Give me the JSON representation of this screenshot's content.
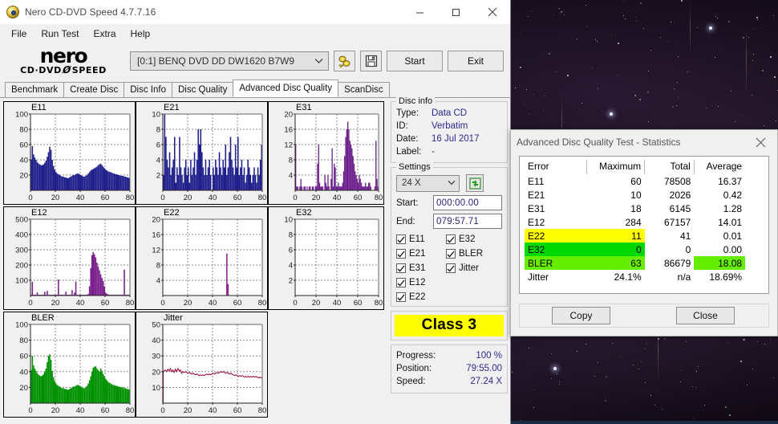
{
  "window": {
    "title": "Nero CD-DVD Speed 4.7.7.16",
    "icon": "nero-disc-icon",
    "minimize_label": "–",
    "maximize_label": "□",
    "close_label": "✕"
  },
  "menubar": [
    {
      "label": "File"
    },
    {
      "label": "Run Test"
    },
    {
      "label": "Extra"
    },
    {
      "label": "Help"
    }
  ],
  "logo": {
    "top": "nero",
    "bottom_left": "CD·DVD",
    "bottom_right": "SPEED"
  },
  "toolbar": {
    "drive_value": "[0:1]   BENQ DVD DD DW1620 B7W9",
    "eject_icon": "eject-disc-icon",
    "save_icon": "floppy-save-icon",
    "start_label": "Start",
    "exit_label": "Exit"
  },
  "tabs": [
    {
      "label": "Benchmark",
      "active": false
    },
    {
      "label": "Create Disc",
      "active": false
    },
    {
      "label": "Disc Info",
      "active": false
    },
    {
      "label": "Disc Quality",
      "active": false
    },
    {
      "label": "Advanced Disc Quality",
      "active": true
    },
    {
      "label": "ScanDisc",
      "active": false
    }
  ],
  "disc_info": {
    "legend": "Disc info",
    "rows": [
      {
        "key": "Type:",
        "value": "Data CD"
      },
      {
        "key": "ID:",
        "value": "Verbatim"
      },
      {
        "key": "Date:",
        "value": "16 Jul 2017"
      },
      {
        "key": "Label:",
        "value": "-"
      }
    ]
  },
  "settings": {
    "legend": "Settings",
    "speed_value": "24 X",
    "refresh_icon": "refresh-icon",
    "start_label": "Start:",
    "start_value": "000:00.00",
    "end_label": "End:",
    "end_value": "079:57.71",
    "checkboxes": [
      {
        "label": "E11",
        "checked": true
      },
      {
        "label": "E32",
        "checked": true
      },
      {
        "label": "E21",
        "checked": true
      },
      {
        "label": "BLER",
        "checked": true
      },
      {
        "label": "E31",
        "checked": true
      },
      {
        "label": "Jitter",
        "checked": true
      },
      {
        "label": "E12",
        "checked": true
      },
      {
        "label": "",
        "checked": null
      },
      {
        "label": "E22",
        "checked": true
      },
      {
        "label": "",
        "checked": null
      }
    ]
  },
  "class_rating": {
    "label": "Class 3",
    "color": "#ffff00"
  },
  "progress_panel": {
    "rows": [
      {
        "key": "Progress:",
        "value": "100 %"
      },
      {
        "key": "Position:",
        "value": "79:55.00"
      },
      {
        "key": "Speed:",
        "value": "27.24 X"
      }
    ]
  },
  "stats_dialog": {
    "title": "Advanced Disc Quality Test - Statistics",
    "close_icon": "close-icon",
    "headers": [
      "Error",
      "Maximum",
      "Total",
      "Average"
    ],
    "rows": [
      {
        "error": "E11",
        "maximum": "60",
        "total": "78508",
        "average": "16.37",
        "highlight": "none"
      },
      {
        "error": "E21",
        "maximum": "10",
        "total": "2026",
        "average": "0.42",
        "highlight": "none"
      },
      {
        "error": "E31",
        "maximum": "18",
        "total": "6145",
        "average": "1.28",
        "highlight": "none"
      },
      {
        "error": "E12",
        "maximum": "284",
        "total": "67157",
        "average": "14.01",
        "highlight": "none"
      },
      {
        "error": "E22",
        "maximum": "11",
        "total": "41",
        "average": "0.01",
        "highlight": "yellow"
      },
      {
        "error": "E32",
        "maximum": "0",
        "total": "0",
        "average": "0.00",
        "highlight": "green"
      },
      {
        "error": "BLER",
        "maximum": "63",
        "total": "86679",
        "average": "18.08",
        "highlight": "lgreen"
      },
      {
        "error": "Jitter",
        "maximum": "24.1%",
        "total": "n/a",
        "average": "18.69%",
        "highlight": "none"
      }
    ],
    "copy_label": "Copy",
    "close_label": "Close"
  },
  "chart_data": [
    {
      "id": "E11",
      "type": "area",
      "title": "E11",
      "color": "#1f1f8c",
      "xlabel": "",
      "ylabel": "",
      "xlim": [
        0,
        80
      ],
      "ylim": [
        0,
        100
      ],
      "xticks": [
        0,
        20,
        40,
        60,
        80
      ],
      "yticks": [
        20,
        40,
        60,
        80,
        100
      ],
      "grid": true,
      "values": [
        40,
        58,
        47,
        43,
        40,
        37,
        35,
        34,
        33,
        33,
        34,
        36,
        39,
        44,
        50,
        57,
        53,
        40,
        32,
        27,
        24,
        22,
        21,
        20,
        19,
        18,
        18,
        17,
        17,
        16,
        16,
        17,
        18,
        19,
        20,
        20,
        21,
        22,
        22,
        21,
        20,
        19,
        18,
        18,
        19,
        20,
        22,
        24,
        26,
        27,
        28,
        29,
        30,
        31,
        33,
        34,
        35,
        33,
        31,
        29,
        27,
        26,
        25,
        24,
        24,
        23,
        22,
        22,
        21,
        21,
        20,
        20,
        19,
        19,
        19,
        18,
        18,
        17,
        17,
        16
      ]
    },
    {
      "id": "E21",
      "type": "area",
      "title": "E21",
      "color": "#1f1f8c",
      "xlim": [
        0,
        80
      ],
      "ylim": [
        0,
        10
      ],
      "xticks": [
        0,
        20,
        40,
        60,
        80
      ],
      "yticks": [
        2,
        4,
        6,
        8,
        10
      ],
      "grid": true,
      "values": [
        2,
        10,
        7,
        4,
        3,
        5,
        2,
        3,
        4,
        7,
        1,
        3,
        2,
        7,
        3,
        2,
        1,
        3,
        4,
        2,
        3,
        1,
        4,
        2,
        3,
        5,
        2,
        4,
        8,
        6,
        8,
        5,
        3,
        2,
        4,
        2,
        3,
        4,
        2,
        0,
        3,
        2,
        4,
        3,
        2,
        5,
        3,
        2,
        4,
        3,
        6,
        2,
        3,
        5,
        7,
        4,
        3,
        2,
        6,
        3,
        7,
        2,
        3,
        4,
        2,
        3,
        1,
        2,
        4,
        3,
        2,
        1,
        2,
        3,
        2,
        1,
        3,
        2,
        4,
        6
      ]
    },
    {
      "id": "E31",
      "type": "area",
      "title": "E31",
      "color": "#6b1f8c",
      "xlim": [
        0,
        80
      ],
      "ylim": [
        0,
        20
      ],
      "xticks": [
        0,
        20,
        40,
        60,
        80
      ],
      "yticks": [
        4,
        8,
        12,
        16,
        20
      ],
      "grid": true,
      "values": [
        12,
        1,
        1,
        0,
        1,
        3,
        1,
        0,
        1,
        1,
        0,
        1,
        0,
        1,
        1,
        0,
        1,
        1,
        0,
        1,
        1,
        7,
        12,
        2,
        1,
        1,
        1,
        0,
        4,
        2,
        1,
        4,
        1,
        0,
        3,
        11,
        1,
        7,
        6,
        1,
        1,
        2,
        1,
        1,
        1,
        2,
        5,
        9,
        14,
        16,
        18,
        16,
        13,
        12,
        11,
        9,
        7,
        5,
        4,
        3,
        2,
        4,
        3,
        2,
        1,
        1,
        1,
        2,
        1,
        1,
        2,
        2,
        1,
        0,
        0,
        0,
        1,
        13,
        3,
        1
      ]
    },
    {
      "id": "E12",
      "type": "area",
      "title": "E12",
      "color": "#7a1f8c",
      "xlim": [
        0,
        80
      ],
      "ylim": [
        0,
        500
      ],
      "xticks": [
        0,
        20,
        40,
        60,
        80
      ],
      "yticks": [
        100,
        200,
        300,
        400,
        500
      ],
      "grid": true,
      "values": [
        5,
        90,
        5,
        5,
        5,
        20,
        5,
        5,
        5,
        5,
        5,
        25,
        5,
        30,
        5,
        5,
        5,
        5,
        5,
        5,
        5,
        5,
        105,
        5,
        5,
        5,
        5,
        5,
        25,
        5,
        5,
        5,
        5,
        35,
        5,
        20,
        90,
        5,
        5,
        5,
        5,
        5,
        5,
        5,
        5,
        5,
        10,
        60,
        180,
        265,
        285,
        270,
        250,
        215,
        190,
        165,
        140,
        115,
        95,
        60,
        20,
        10,
        8,
        5,
        5,
        5,
        5,
        5,
        5,
        5,
        5,
        5,
        5,
        5,
        5,
        170,
        5,
        5,
        5,
        5
      ]
    },
    {
      "id": "E22",
      "type": "area",
      "title": "E22",
      "color": "#8c1f8c",
      "xlim": [
        0,
        80
      ],
      "ylim": [
        0,
        20
      ],
      "xticks": [
        0,
        20,
        40,
        60,
        80
      ],
      "yticks": [
        4,
        8,
        12,
        16,
        20
      ],
      "grid": true,
      "values": [
        0,
        0,
        0,
        0,
        0,
        0,
        0,
        0,
        0,
        0,
        0,
        0,
        0,
        0,
        0,
        0,
        0,
        0,
        0,
        0,
        0,
        0,
        0,
        0,
        0,
        0,
        0,
        0,
        0,
        0,
        0,
        0,
        0,
        0,
        0,
        0,
        0,
        0,
        0,
        0,
        0,
        0,
        0,
        0,
        0,
        0,
        0,
        0,
        0,
        0,
        0,
        11,
        3,
        0,
        0,
        0,
        0,
        0,
        0,
        0,
        0,
        0,
        0,
        0,
        0,
        0,
        0,
        0,
        0,
        0,
        0,
        0,
        0,
        0,
        0,
        0,
        0,
        0,
        0,
        0
      ]
    },
    {
      "id": "E32",
      "type": "area",
      "title": "E32",
      "color": "#8c1f8c",
      "xlim": [
        0,
        80
      ],
      "ylim": [
        0,
        10
      ],
      "xticks": [
        0,
        20,
        40,
        60,
        80
      ],
      "yticks": [
        2,
        4,
        6,
        8,
        10
      ],
      "grid": true,
      "values": [
        0,
        0,
        0,
        0,
        0,
        0,
        0,
        0,
        0,
        0,
        0,
        0,
        0,
        0,
        0,
        0,
        0,
        0,
        0,
        0,
        0,
        0,
        0,
        0,
        0,
        0,
        0,
        0,
        0,
        0,
        0,
        0,
        0,
        0,
        0,
        0,
        0,
        0,
        0,
        0,
        0,
        0,
        0,
        0,
        0,
        0,
        0,
        0,
        0,
        0,
        0,
        0,
        0,
        0,
        0,
        0,
        0,
        0,
        0,
        0,
        0,
        0,
        0,
        0,
        0,
        0,
        0,
        0,
        0,
        0,
        0,
        0,
        0,
        0,
        0,
        0,
        0,
        0,
        0,
        0
      ]
    },
    {
      "id": "BLER",
      "type": "area",
      "title": "BLER",
      "color": "#009100",
      "xlim": [
        0,
        80
      ],
      "ylim": [
        0,
        100
      ],
      "xticks": [
        0,
        20,
        40,
        60,
        80
      ],
      "yticks": [
        20,
        40,
        60,
        80,
        100
      ],
      "grid": true,
      "values": [
        42,
        60,
        48,
        44,
        41,
        38,
        36,
        35,
        34,
        35,
        37,
        40,
        44,
        52,
        60,
        62,
        55,
        41,
        33,
        28,
        25,
        23,
        22,
        21,
        20,
        19,
        19,
        18,
        18,
        17,
        17,
        18,
        19,
        20,
        21,
        21,
        22,
        23,
        23,
        22,
        21,
        20,
        19,
        19,
        20,
        22,
        25,
        29,
        34,
        40,
        45,
        46,
        47,
        44,
        42,
        40,
        44,
        41,
        37,
        34,
        31,
        29,
        27,
        26,
        25,
        24,
        23,
        23,
        22,
        22,
        21,
        21,
        20,
        20,
        20,
        19,
        19,
        18,
        18,
        17
      ]
    },
    {
      "id": "Jitter",
      "type": "line",
      "title": "Jitter",
      "color": "#9e1243",
      "xlim": [
        0,
        80
      ],
      "ylim": [
        0,
        50
      ],
      "xticks": [
        0,
        20,
        40,
        60,
        80
      ],
      "yticks": [
        10,
        20,
        30,
        40,
        50
      ],
      "grid": true,
      "values": [
        19.0,
        20.5,
        21.0,
        20.0,
        21.5,
        20.5,
        22.0,
        20.0,
        21.0,
        19.5,
        21.5,
        20.0,
        22.0,
        20.5,
        21.0,
        19.0,
        20.0,
        19.5,
        20.0,
        19.5,
        19.0,
        19.5,
        19.0,
        18.5,
        19.0,
        18.5,
        18.0,
        18.5,
        18.0,
        17.5,
        18.0,
        17.5,
        18.0,
        17.5,
        18.0,
        18.5,
        18.0,
        18.5,
        18.0,
        18.5,
        19.0,
        18.5,
        19.0,
        19.5,
        19.0,
        19.5,
        20.0,
        19.5,
        20.0,
        19.5,
        19.0,
        19.5,
        19.0,
        18.5,
        19.0,
        18.5,
        18.0,
        17.5,
        18.0,
        17.5,
        17.0,
        17.5,
        17.0,
        17.5,
        17.0,
        16.5,
        17.0,
        16.5,
        17.0,
        16.5,
        17.0,
        16.5,
        17.0,
        16.5,
        17.0,
        16.5,
        16.0,
        16.5,
        16.0,
        16.5
      ]
    }
  ]
}
